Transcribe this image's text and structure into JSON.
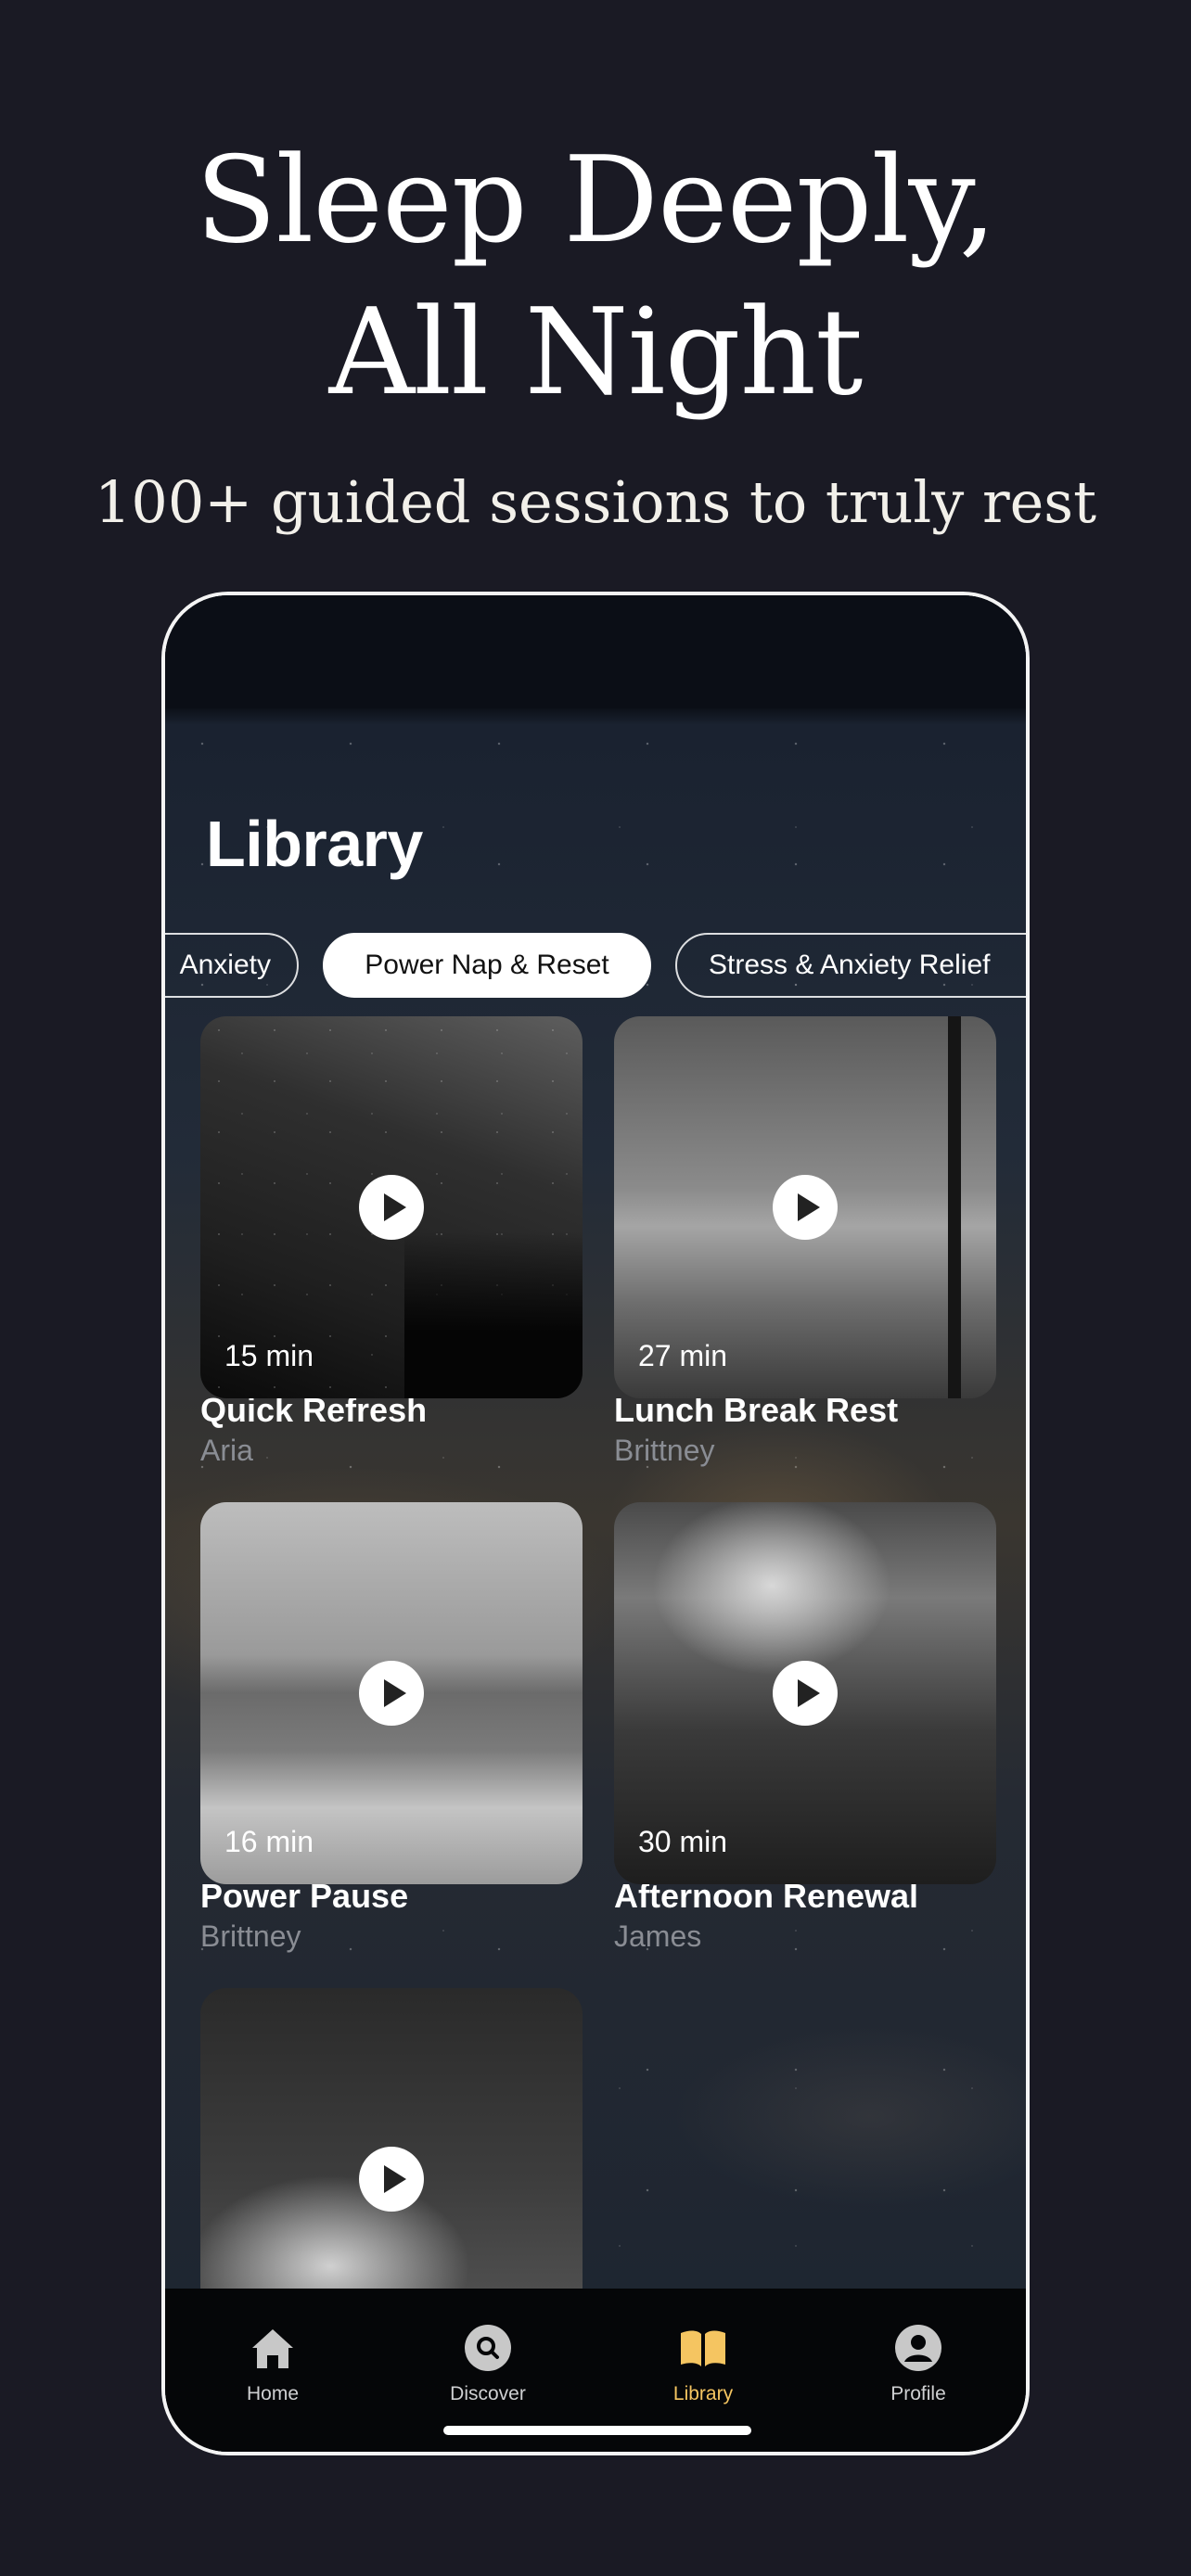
{
  "hero": {
    "headline_line1": "Sleep Deeply,",
    "headline_line2": "All Night",
    "subheadline": "100+ guided sessions to truly rest"
  },
  "screen": {
    "title": "Library",
    "chips": [
      {
        "label": "Anxiety",
        "active": false
      },
      {
        "label": "Power Nap & Reset",
        "active": true
      },
      {
        "label": "Stress & Anxiety Relief",
        "active": false
      }
    ],
    "sessions": [
      {
        "duration": "15 min",
        "title": "Quick Refresh",
        "author": "Aria"
      },
      {
        "duration": "27 min",
        "title": "Lunch Break Rest",
        "author": "Brittney"
      },
      {
        "duration": "16 min",
        "title": "Power Pause",
        "author": "Brittney"
      },
      {
        "duration": "30 min",
        "title": "Afternoon Renewal",
        "author": "James"
      },
      {
        "duration": "",
        "title": "",
        "author": ""
      }
    ],
    "tabs": [
      {
        "label": "Home",
        "icon": "home-icon"
      },
      {
        "label": "Discover",
        "icon": "search-icon"
      },
      {
        "label": "Library",
        "icon": "book-icon",
        "active": true
      },
      {
        "label": "Profile",
        "icon": "profile-icon"
      }
    ]
  },
  "colors": {
    "background": "#1a1a24",
    "accent": "#f5c561",
    "text": "#ffffff"
  }
}
